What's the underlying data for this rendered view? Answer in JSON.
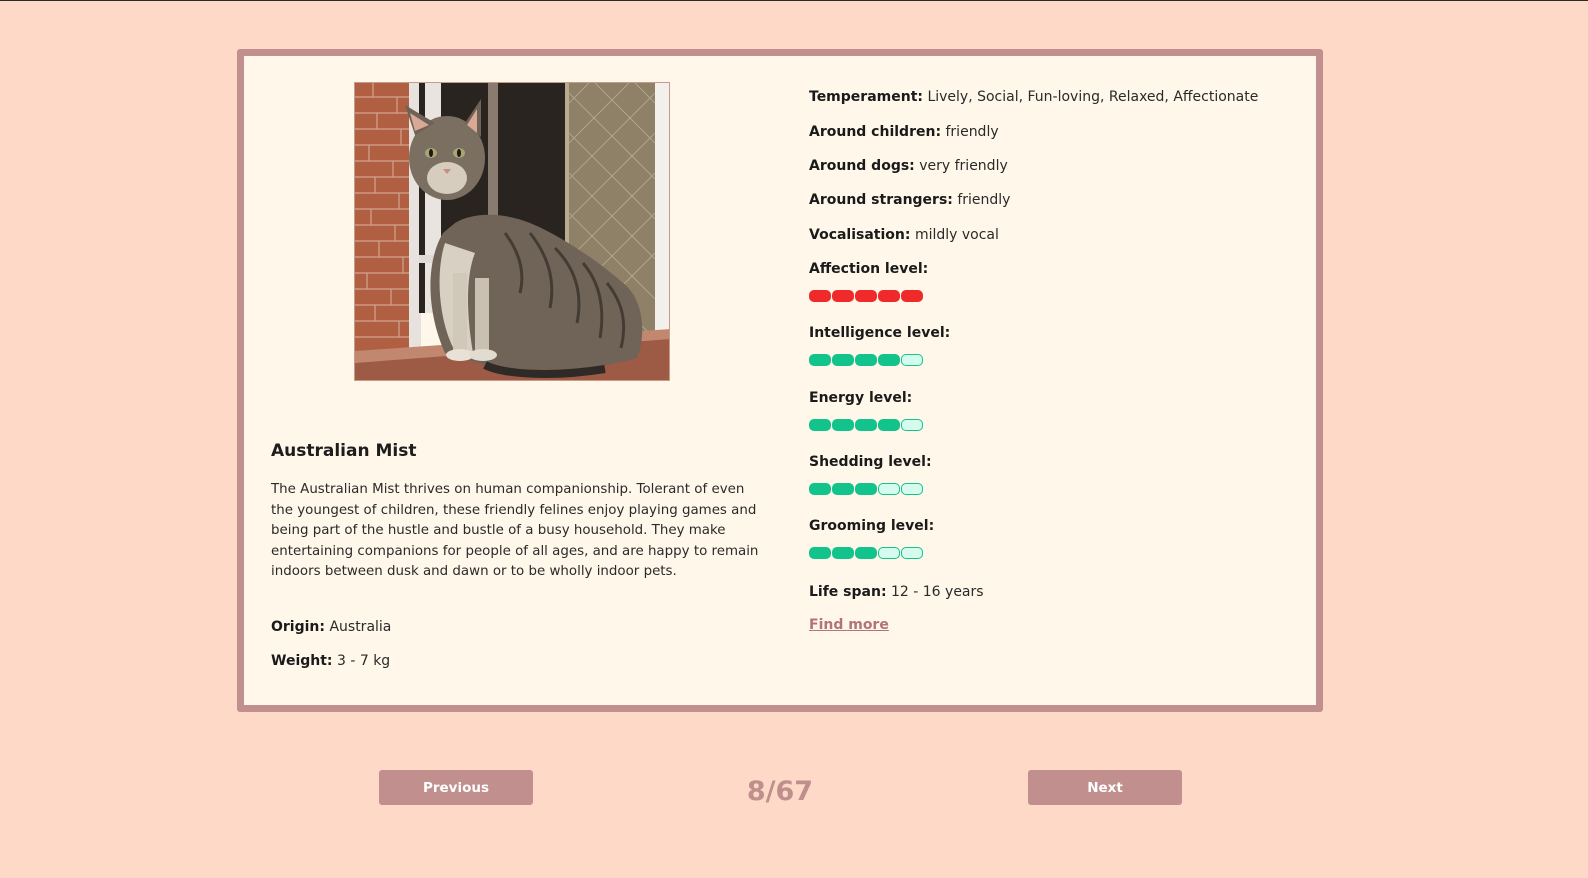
{
  "breed": {
    "name": "Australian Mist",
    "description": "The Australian Mist thrives on human companionship. Tolerant of even the youngest of children, these friendly felines enjoy playing games and being part of the hustle and bustle of a busy household. They make entertaining companions for people of all ages, and are happy to remain indoors between dusk and dawn or to be wholly indoor pets.",
    "origin_label": "Origin:",
    "origin": "Australia",
    "weight_label": "Weight:",
    "weight": "3 - 7 kg",
    "temperament_label": "Temperament:",
    "temperament": "Lively, Social, Fun-loving, Relaxed, Affectionate",
    "children_label": "Around children:",
    "children": "friendly",
    "dogs_label": "Around dogs:",
    "dogs": "very friendly",
    "strangers_label": "Around strangers:",
    "strangers": "friendly",
    "vocalisation_label": "Vocalisation:",
    "vocalisation": "mildly vocal",
    "life_span_label": "Life span:",
    "life_span": "12 - 16 years",
    "find_more": "Find more"
  },
  "levels": [
    {
      "label": "Affection level:",
      "value": 5,
      "max": 5,
      "color": "#f02a2a"
    },
    {
      "label": "Intelligence level:",
      "value": 4,
      "max": 5,
      "color": "#12c48b"
    },
    {
      "label": "Energy level:",
      "value": 4,
      "max": 5,
      "color": "#12c48b"
    },
    {
      "label": "Shedding level:",
      "value": 3,
      "max": 5,
      "color": "#12c48b"
    },
    {
      "label": "Grooming level:",
      "value": 3,
      "max": 5,
      "color": "#12c48b"
    }
  ],
  "pill_empty_fill": "#d5fbef",
  "pagination": {
    "previous": "Previous",
    "next": "Next",
    "counter": "8/67"
  }
}
